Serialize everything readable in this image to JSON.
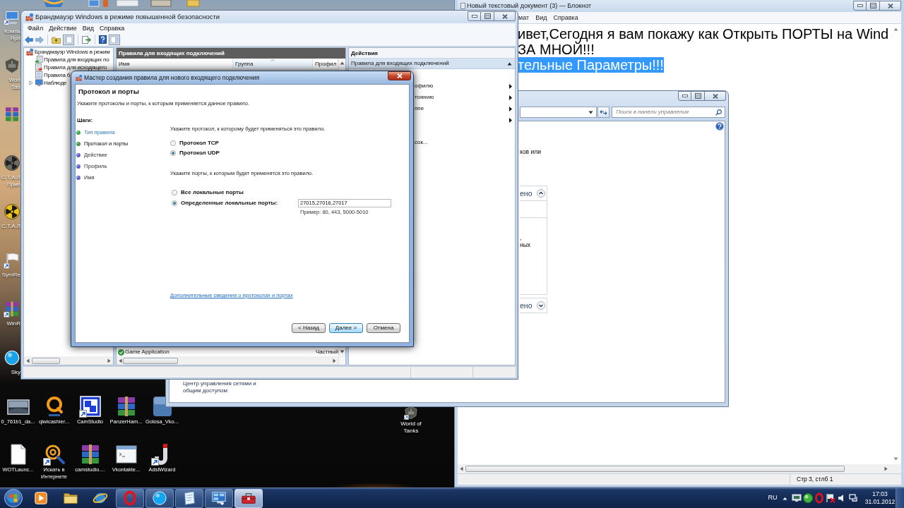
{
  "desktop": {
    "edge_icons": [
      {
        "lines": [
          "Компь",
          "Ярл"
        ],
        "kind": "computer",
        "shortcut": true
      },
      {
        "lines": [
          "Worl",
          "Tan"
        ],
        "kind": "emblem",
        "shortcut": false
      },
      {
        "kind": "archive",
        "shortcut": false
      },
      {
        "lines": [
          "С.Т.А.Л",
          "Прип"
        ],
        "kind": "hazard",
        "shortcut": false
      },
      {
        "lines": [
          "С.Т.А.Л"
        ],
        "kind": "radiation",
        "shortcut": false
      },
      {
        "lines": [
          "SymRe"
        ],
        "kind": "flag",
        "shortcut": true
      },
      {
        "lines": [
          "WinR"
        ],
        "kind": "archive",
        "shortcut": true
      },
      {
        "lines": [
          "Sky"
        ],
        "kind": "bubble",
        "shortcut": false
      }
    ],
    "rows": [
      [
        {
          "label": "0_761b1_da...",
          "kind": "photo",
          "shortcut": false
        },
        {
          "label": "qiwicashier...",
          "kind": "ring",
          "shortcut": false
        },
        {
          "label": "CamStudio",
          "kind": "squares",
          "shortcut": true
        },
        {
          "label": "PanzerHam...",
          "kind": "archive",
          "shortcut": false
        },
        {
          "label": "Golosa_Vko...",
          "kind": "tile",
          "shortcut": false
        }
      ],
      [
        {
          "label": "WOTLaunc...",
          "kind": "document",
          "shortcut": false
        },
        {
          "label": "Искать в Интернете",
          "kind": "magnifier",
          "shortcut": true
        },
        {
          "label": "camstudio....",
          "kind": "archive",
          "shortcut": false
        },
        {
          "label": "Vkontakte...",
          "kind": "window",
          "shortcut": false
        },
        {
          "label": "AdslWizard",
          "kind": "hook",
          "shortcut": true
        }
      ]
    ],
    "lone_icon": {
      "label": "World of Tanks",
      "kind": "emblem",
      "shortcut": true
    }
  },
  "notepad": {
    "title": "Новый текстовый документ (3) — Блокнот",
    "menu": [
      "мат",
      "Вид",
      "Справка"
    ],
    "lines": [
      {
        "text": "ивет,Сегодня я вам покажу как Открыть ПОРТЫ на Wind",
        "selected": false
      },
      {
        "text": "ЗА МНОЙ!!!",
        "selected": false
      },
      {
        "text": "тельные Параметры!!!",
        "selected": true
      }
    ],
    "status": "Стр 3, стлб 1"
  },
  "control_panel": {
    "search": {
      "placeholder": "Поиск в панели управления"
    },
    "fragment": "ков или",
    "sections": [
      {
        "label": "ено",
        "expanded": true,
        "lines": [
          ",",
          "ных"
        ]
      },
      {
        "label": "ено",
        "expanded": false
      }
    ],
    "nav_link": "Центр управления сетями и общим доступом"
  },
  "firewall": {
    "title": "Брандмауэр Windows в режиме повышенной безопасности",
    "menu": [
      "Файл",
      "Действие",
      "Вид",
      "Справка"
    ],
    "tree": [
      {
        "label": "Брандмауэр Windows в режим",
        "kind": "firewall",
        "children": [
          {
            "label": "Правила для входящих по",
            "kind": "inbound"
          },
          {
            "label": "Правила для исходящего",
            "kind": "outbound"
          },
          {
            "label": "Правила б",
            "kind": "security"
          },
          {
            "label": "Наблюде",
            "kind": "monitoring",
            "expanded": false
          }
        ]
      }
    ],
    "rules": {
      "title": "Правила для входящих подключений",
      "columns": [
        {
          "label": "Имя",
          "sorted": false
        },
        {
          "label": "Группа",
          "sorted": true
        },
        {
          "label": "Профил",
          "sorted": false
        }
      ],
      "rows": [
        {
          "name": "Game Application",
          "profile": "Частный",
          "enabled": true
        }
      ]
    },
    "actions": {
      "title": "Действия",
      "items": [
        {
          "kind": "header",
          "label": "Правила для входящих подключений",
          "expanded": true
        },
        {
          "kind": "submenu",
          "label": "офилю"
        },
        {
          "kind": "submenu",
          "label": "тоянию"
        },
        {
          "kind": "submenu",
          "label": "ппе"
        },
        {
          "kind": "submenu"
        },
        {
          "kind": "command",
          "label": "сок..."
        }
      ]
    }
  },
  "wizard": {
    "title": "Мастер создания правила для нового входящего подключения",
    "heading": "Протокол и порты",
    "description": "Укажите протоколы и порты, к которым применяется данное правило.",
    "steps_title": "Шаги:",
    "steps": [
      {
        "label": "Тип правила",
        "kind": "link",
        "selected": false
      },
      {
        "label": "Протокол и порты",
        "kind": "text",
        "selected": true
      },
      {
        "label": "Действие",
        "kind": "text",
        "selected": false
      },
      {
        "label": "Профиль",
        "kind": "text",
        "selected": false
      },
      {
        "label": "Имя",
        "kind": "text",
        "selected": false
      }
    ],
    "protocol_prompt": "Укажите протокол, к которому будет применяться это правило.",
    "protocols": [
      {
        "label": "Протокол TCP",
        "selected": false
      },
      {
        "label": "Протокол UDP",
        "selected": true
      }
    ],
    "ports_prompt": "Укажите порты, к которым будет применятся это правило.",
    "ports": [
      {
        "label": "Все локальные порты",
        "selected": false
      },
      {
        "label": "Определенные локальные порты:",
        "selected": true,
        "value": "27015,27016,27017",
        "hint": "Пример: 80, 443, 5000-5010"
      }
    ],
    "help_link": "Дополнительные сведения о протоколах и портах",
    "buttons": [
      {
        "label": "< Назад",
        "default": false
      },
      {
        "label": "Далее >",
        "default": true
      },
      {
        "label": "Отмена",
        "default": false
      }
    ]
  },
  "taskbar": {
    "apps": [
      {
        "kind": "media",
        "running": false,
        "active": false
      },
      {
        "kind": "explorer",
        "running": false,
        "active": false
      },
      {
        "kind": "ie",
        "running": false,
        "active": false
      },
      {
        "kind": "opera",
        "running": true,
        "active": false
      },
      {
        "kind": "skype",
        "running": true,
        "active": false
      },
      {
        "kind": "paper",
        "running": true,
        "active": false
      },
      {
        "kind": "control",
        "running": true,
        "active": false
      },
      {
        "kind": "toolbox",
        "running": true,
        "active": true
      }
    ],
    "tray": {
      "language": "RU",
      "time": "17:03",
      "date": "31.01.2012"
    }
  }
}
